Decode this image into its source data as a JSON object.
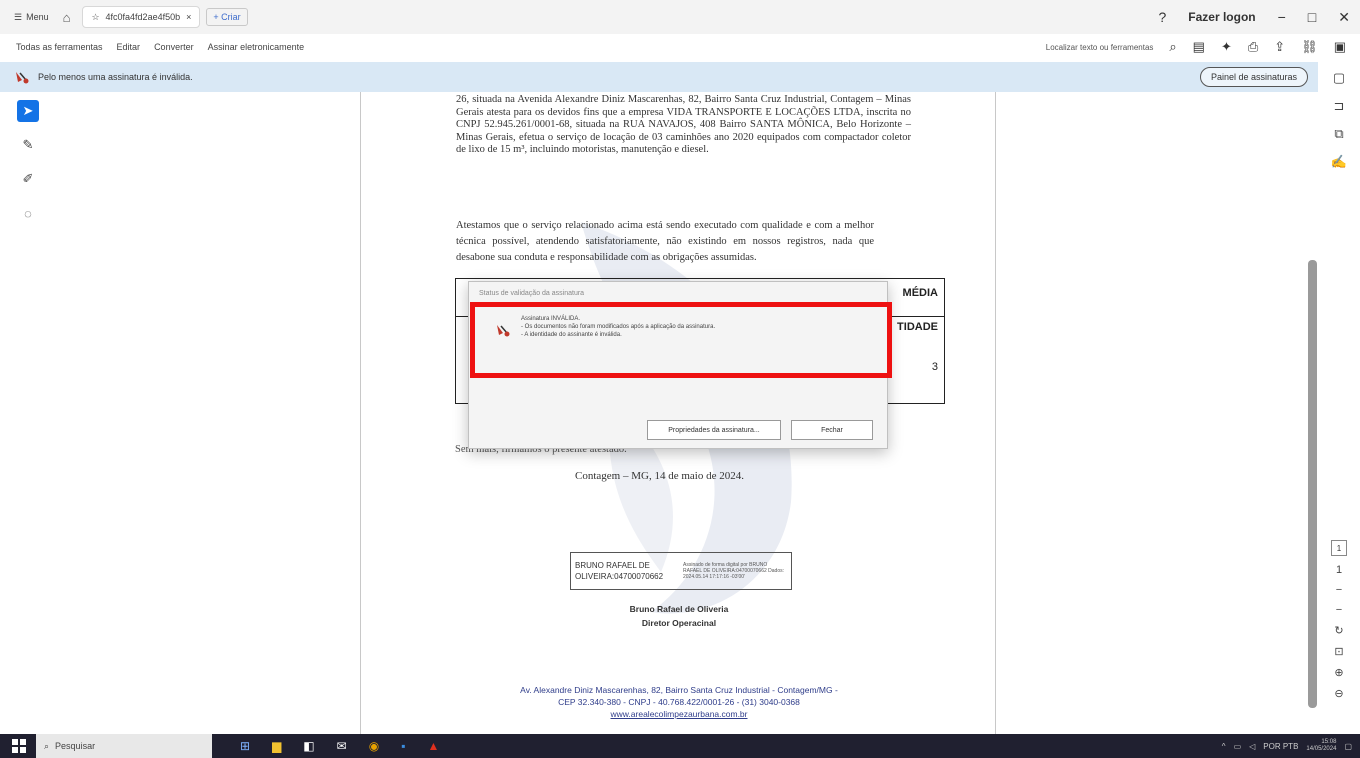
{
  "titlebar": {
    "menu_label": "Menu",
    "tab_title": "4fc0fa4fd2ae4f50b",
    "new_tab_label": "+ Criar",
    "login_label": "Fazer logon"
  },
  "toolbar": {
    "items": [
      "Todas as ferramentas",
      "Editar",
      "Converter",
      "Assinar eletronicamente"
    ],
    "search_label": "Localizar texto ou ferramentas"
  },
  "signature_bar": {
    "message": "Pelo menos uma assinatura é inválida.",
    "panel_button": "Painel de assinaturas"
  },
  "document": {
    "paragraph1": "26, situada na Avenida Alexandre Diniz Mascarenhas, 82, Bairro Santa Cruz Industrial, Contagem – Minas Gerais atesta para os devidos fins que a empresa VIDA TRANSPORTE E LOCAÇÕES LTDA, inscrita no CNPJ 52.945.261/0001-68, situada na RUA NAVAJOS, 408 Bairro SANTA MÔNICA, Belo Horizonte – Minas Gerais, efetua o serviço de locação de 03 caminhões ano 2020 equipados com compactador coletor de lixo de 15 m³, incluindo motoristas, manutenção e diesel.",
    "paragraph2": "Atestamos que o serviço relacionado acima está sendo executado com qualidade e com a melhor técnica possível, atendendo satisfatoriamente, não existindo em nossos registros, nada que desabone sua conduta e responsabilidade com as obrigações assumidas.",
    "table_header_media": "MÉDIA",
    "table_header_qtd": "TIDADE",
    "table_value": "3",
    "after_table": "Sem mais, firmamos o presente atestado.",
    "date_line": "Contagem – MG, 14 de maio de 2024.",
    "signature_name": "BRUNO RAFAEL DE OLIVEIRA:04700070662",
    "signature_meta": "Assinado de forma digital por BRUNO RAFAEL DE OLIVEIRA:04700070662 Dados: 2024.05.14 17:17:16 -03'00'",
    "signer_name": "Bruno Rafael de Oliveria",
    "signer_title": "Diretor Operacinal",
    "footer_line1": "Av. Alexandre Diniz Mascarenhas, 82, Bairro Santa Cruz Industrial - Contagem/MG -",
    "footer_line2": "CEP 32.340-380 - CNPJ - 40.768.422/0001-26 - (31) 3040-0368",
    "footer_line3": "www.arealecolimpezaurbana.com.br"
  },
  "dialog": {
    "title": "Status de validação da assinatura",
    "message_line1": "Assinatura INVÁLIDA.",
    "message_line2": "- Os documentos não foram modificados após a aplicação da assinatura.",
    "message_line3": "- A identidade do assinante é inválida.",
    "properties_button": "Propriedades da assinatura...",
    "close_button": "Fechar"
  },
  "page_indicator": {
    "current": "1",
    "total": "1"
  },
  "taskbar": {
    "search_placeholder": "Pesquisar",
    "time": "15:08",
    "date": "14/05/2024",
    "lang": "POR PTB"
  },
  "colors": {
    "accent": "#1473e6",
    "highlight": "#ee1111",
    "sigbar_bg": "#d9e8f5",
    "taskbar_bg": "#202030"
  }
}
